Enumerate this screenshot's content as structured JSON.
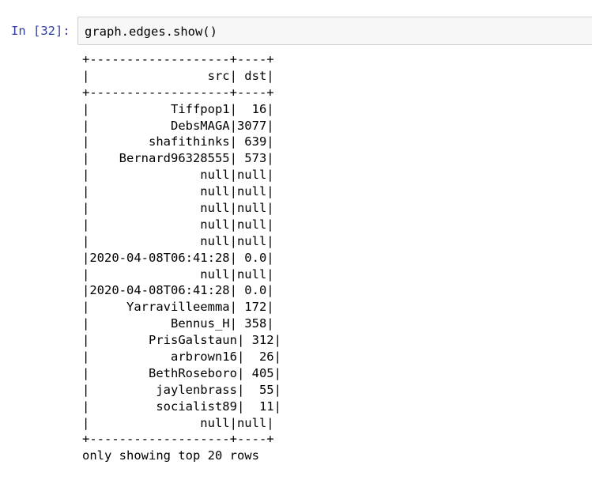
{
  "cell": {
    "prompt": "In [32]:",
    "code": "graph.edges.show()"
  },
  "output": {
    "border_line": "+-------------------+----+",
    "header_row": "|                src| dst|",
    "rows": [
      "|           Tiffpop1|  16|",
      "|           DebsMAGA|3077|",
      "|        shafithinks| 639|",
      "|    Bernard96328555| 573|",
      "|               null|null|",
      "|               null|null|",
      "|               null|null|",
      "|               null|null|",
      "|               null|null|",
      "|2020-04-08T06:41:28| 0.0|",
      "|               null|null|",
      "|2020-04-08T06:41:28| 0.0|",
      "|     Yarravilleemma| 172|",
      "|           Bennus_H| 358|",
      "|        PrisGalstaun| 312|",
      "|           arbrown16|  26|",
      "|        BethRoseboro| 405|",
      "|         jaylenbrass|  55|",
      "|         socialist89|  11|",
      "|               null|null|"
    ],
    "footer": "only showing top 20 rows"
  }
}
